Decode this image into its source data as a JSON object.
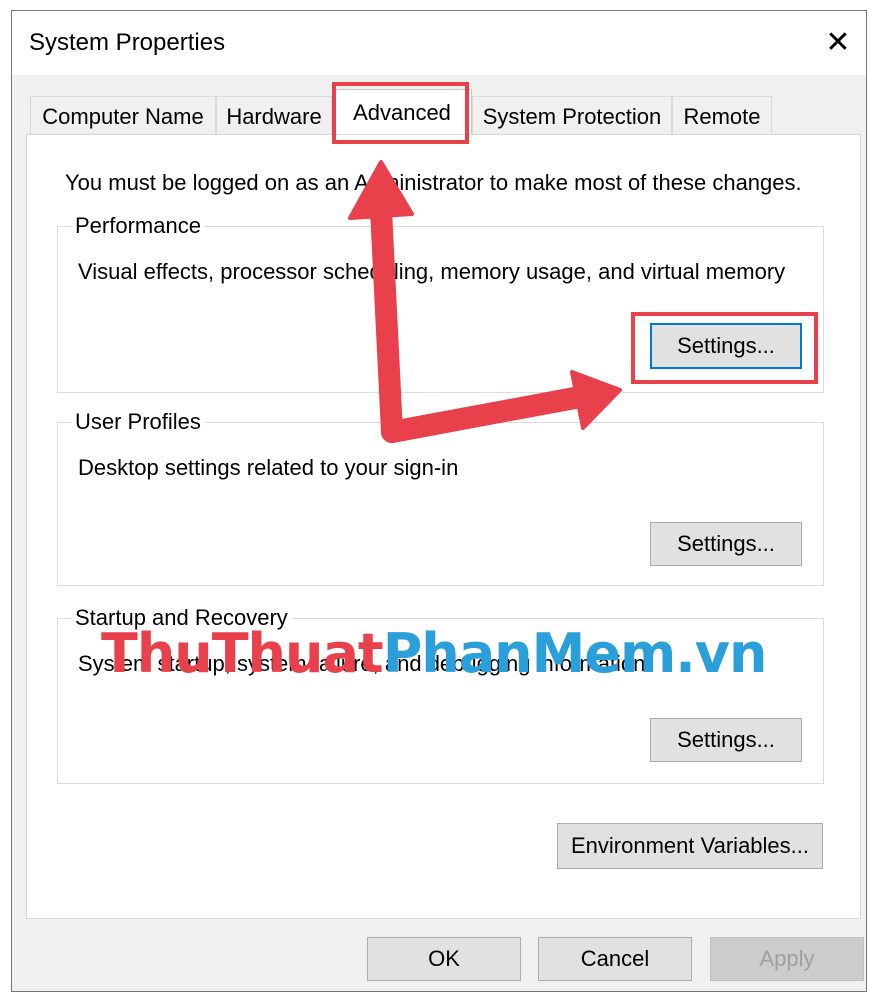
{
  "window": {
    "title": "System Properties",
    "close_glyph": "✕"
  },
  "tabs": [
    {
      "label": "Computer Name"
    },
    {
      "label": "Hardware"
    },
    {
      "label": "Advanced",
      "active": true
    },
    {
      "label": "System Protection"
    },
    {
      "label": "Remote"
    }
  ],
  "notice": "You must be logged on as an Administrator to make most of these changes.",
  "performance": {
    "title": "Performance",
    "description": "Visual effects, processor scheduling, memory usage, and virtual memory",
    "button": "Settings..."
  },
  "user_profiles": {
    "title": "User Profiles",
    "description": "Desktop settings related to your sign-in",
    "button": "Settings..."
  },
  "startup_recovery": {
    "title": "Startup and Recovery",
    "description": "System startup, system failure, and debugging information",
    "button": "Settings..."
  },
  "env_button": "Environment Variables...",
  "footer": {
    "ok": "OK",
    "cancel": "Cancel",
    "apply": "Apply"
  },
  "watermark": {
    "part1": "ThuThuat",
    "part2": "PhanMem",
    "part3": ".vn"
  },
  "annotation_colors": {
    "highlight": "#e8414b",
    "watermark_blue": "#2a9fd9"
  }
}
